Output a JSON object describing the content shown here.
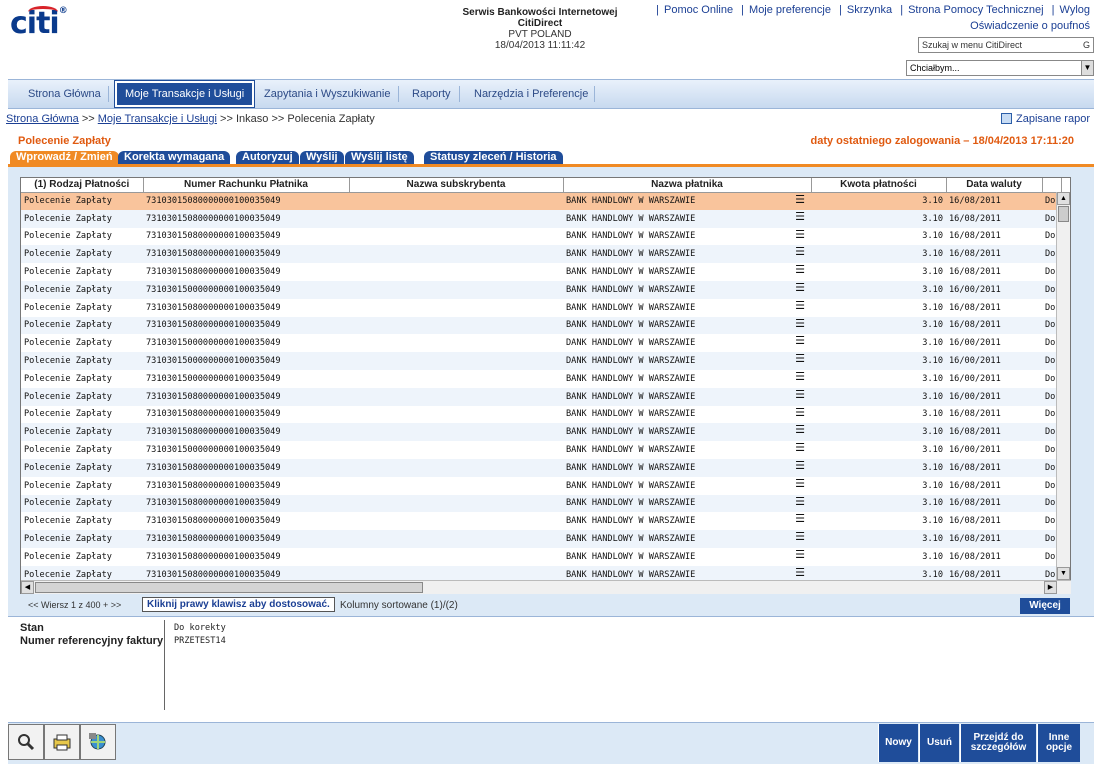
{
  "header": {
    "brand": "citi",
    "service_title": "Serwis Bankowości Internetowej",
    "service_name": "CitiDirect",
    "org": "PVT POLAND",
    "datetime": "18/04/2013 11:11:42",
    "links": [
      "Pomoc Online",
      "Moje preferencje",
      "Skrzynka",
      "Strona Pomocy Technicznej",
      "Wylog"
    ],
    "oswiadczenie": "Oświadczenie o poufnoś",
    "search_placeholder": "Szukaj w menu CitiDirect",
    "search_go": "G",
    "chcial": "Chciałbym..."
  },
  "nav": {
    "items": [
      "Strona Główna",
      "Moje Transakcje i Usługi",
      "Zapytania i Wyszukiwanie",
      "Raporty",
      "Narzędzia i Preferencje"
    ],
    "active_index": 1
  },
  "breadcrumb": {
    "home": "Strona Główna",
    "sep": ">>",
    "transakcje": "Moje Transakcje i Usługi",
    "inkaso": "Inkaso",
    "current": "Polecenia Zapłaty"
  },
  "zapisane": "Zapisane rapor",
  "page_title": "Polecenie Zapłaty",
  "last_login": "daty ostatniego zalogowania – 18/04/2013 17:11:20",
  "tabs": [
    "Wprowadź / Zmień",
    "Korekta wymagana",
    "Autoryzuj",
    "Wyślij",
    "Wyślij listę",
    "Statusy zleceń / Historia"
  ],
  "grid": {
    "columns": [
      "(1) Rodzaj Płatności",
      "Numer Rachunku Płatnika",
      "Nazwa subskrybenta",
      "Nazwa płatnika",
      "Kwota płatności",
      "Data waluty",
      ""
    ],
    "rows": [
      {
        "type": "Polecenie Zapłaty",
        "account": "73103015080000000100035049",
        "payer": "BANK HANDLOWY W WARSZAWIE",
        "amount": "3.10",
        "date": "16/08/2011",
        "extra": "Do"
      },
      {
        "type": "Polecenie Zapłaty",
        "account": "73103015080000000100035049",
        "payer": "BANK HANDLOWY W WARSZAWIE",
        "amount": "3.10",
        "date": "16/08/2011",
        "extra": "Do"
      },
      {
        "type": "Polecenie Zapłaty",
        "account": "73103015080000000100035049",
        "payer": "BANK HANDLOWY W WARSZAWIE",
        "amount": "3.10",
        "date": "16/08/2011",
        "extra": "Do"
      },
      {
        "type": "Polecenie Zapłaty",
        "account": "73103015080000000100035049",
        "payer": "BANK HANDLOWY W WARSZAWIE",
        "amount": "3.10",
        "date": "16/08/2011",
        "extra": "Do"
      },
      {
        "type": "Polecenie Zapłaty",
        "account": "73103015080000000100035049",
        "payer": "BANK HANDLOWY W WARSZAWIE",
        "amount": "3.10",
        "date": "16/08/2011",
        "extra": "Do"
      },
      {
        "type": "Polecenie Zapłaty",
        "account": "73103015000000000100035049",
        "payer": "BANK HANDLOWY W WARSZAWIE",
        "amount": "3.10",
        "date": "16/00/2011",
        "extra": "Do"
      },
      {
        "type": "Polecenie Zapłaty",
        "account": "73103015080000000100035049",
        "payer": "BANK HANDLOWY W WARSZAWIE",
        "amount": "3.10",
        "date": "16/08/2011",
        "extra": "Do"
      },
      {
        "type": "Polecenie Zapłaty",
        "account": "73103015080000000100035049",
        "payer": "BANK HANDLOWY W WARSZAWIE",
        "amount": "3.10",
        "date": "16/08/2011",
        "extra": "Do"
      },
      {
        "type": "Polecenie Zapłaty",
        "account": "73103015000000000100035049",
        "payer": "DANK HANDLOWY W WARSZAWIE",
        "amount": "3.10",
        "date": "16/00/2011",
        "extra": "Do"
      },
      {
        "type": "Polecenie Zapłaty",
        "account": "73103015000000000100035049",
        "payer": "DANK HANDLOWY W WARSZAWIE",
        "amount": "3.10",
        "date": "16/00/2011",
        "extra": "Do"
      },
      {
        "type": "Polecenie Zapłaty",
        "account": "73103015000000000100035049",
        "payer": "BANK HANDLOWY W WARSZAWIE",
        "amount": "3.10",
        "date": "16/00/2011",
        "extra": "Do"
      },
      {
        "type": "Polecenie Zapłaty",
        "account": "73103015080000000100035049",
        "payer": "BANK HANDLOWY W WARSZAWIE",
        "amount": "3.10",
        "date": "16/00/2011",
        "extra": "Do"
      },
      {
        "type": "Polecenie Zapłaty",
        "account": "73103015080000000100035049",
        "payer": "BANK HANDLOWY W WARSZAWIE",
        "amount": "3.10",
        "date": "16/08/2011",
        "extra": "Do"
      },
      {
        "type": "Polecenie Zapłaty",
        "account": "73103015080000000100035049",
        "payer": "BANK HANDLOWY W WARSZAWIE",
        "amount": "3.10",
        "date": "16/08/2011",
        "extra": "Do"
      },
      {
        "type": "Polecenie Zapłaty",
        "account": "73103015000000000100035049",
        "payer": "BANK HANDLOWY W WARSZAWIE",
        "amount": "3.10",
        "date": "16/00/2011",
        "extra": "Do"
      },
      {
        "type": "Polecenie Zapłaty",
        "account": "73103015080000000100035049",
        "payer": "BANK HANDLOWY W WARSZAWIE",
        "amount": "3.10",
        "date": "16/08/2011",
        "extra": "Do"
      },
      {
        "type": "Polecenie Zapłaty",
        "account": "73103015080000000100035049",
        "payer": "BANK HANDLOWY W WARSZAWIE",
        "amount": "3.10",
        "date": "16/08/2011",
        "extra": "Do"
      },
      {
        "type": "Polecenie Zapłaty",
        "account": "73103015080000000100035049",
        "payer": "BANK HANDLOWY W WARSZAWIE",
        "amount": "3.10",
        "date": "16/08/2011",
        "extra": "Do"
      },
      {
        "type": "Polecenie Zapłaty",
        "account": "73103015080000000100035049",
        "payer": "BANK HANDLOWY W WARSZAWIE",
        "amount": "3.10",
        "date": "16/08/2011",
        "extra": "Do"
      },
      {
        "type": "Polecenie Zapłaty",
        "account": "73103015080000000100035049",
        "payer": "BANK HANDLOWY W WARSZAWIE",
        "amount": "3.10",
        "date": "16/08/2011",
        "extra": "Do"
      },
      {
        "type": "Polecenie Zapłaty",
        "account": "73103015080000000100035049",
        "payer": "BANK HANDLOWY W WARSZAWIE",
        "amount": "3.10",
        "date": "16/08/2011",
        "extra": "Do"
      },
      {
        "type": "Polecenie Zapłaty",
        "account": "73103015080000000100035049",
        "payer": "BANK HANDLOWY W WARSZAWIE",
        "amount": "3.10",
        "date": "16/08/2011",
        "extra": "Do"
      }
    ],
    "selected_row": 0
  },
  "pager": "<< Wiersz 1 z 400 + >>",
  "kliknij": "Kliknij prawy klawisz aby dostosować.",
  "kolumny": "Kolumny sortowane (1)/(2)",
  "wiecej": "Więcej",
  "details": {
    "stan_label": "Stan",
    "stan_value": "Do korekty",
    "ref_label": "Numer referencyjny faktury",
    "ref_value": "PRZETEST14"
  },
  "bottom_buttons": {
    "nowy": "Nowy",
    "usun": "Usuń",
    "przejdz": "Przejdź do szczegółów",
    "inne": "Inne opcje"
  },
  "colors": {
    "brand_blue": "#1f4d9a",
    "accent_orange": "#f08a24",
    "selected_row": "#f9c49c"
  }
}
